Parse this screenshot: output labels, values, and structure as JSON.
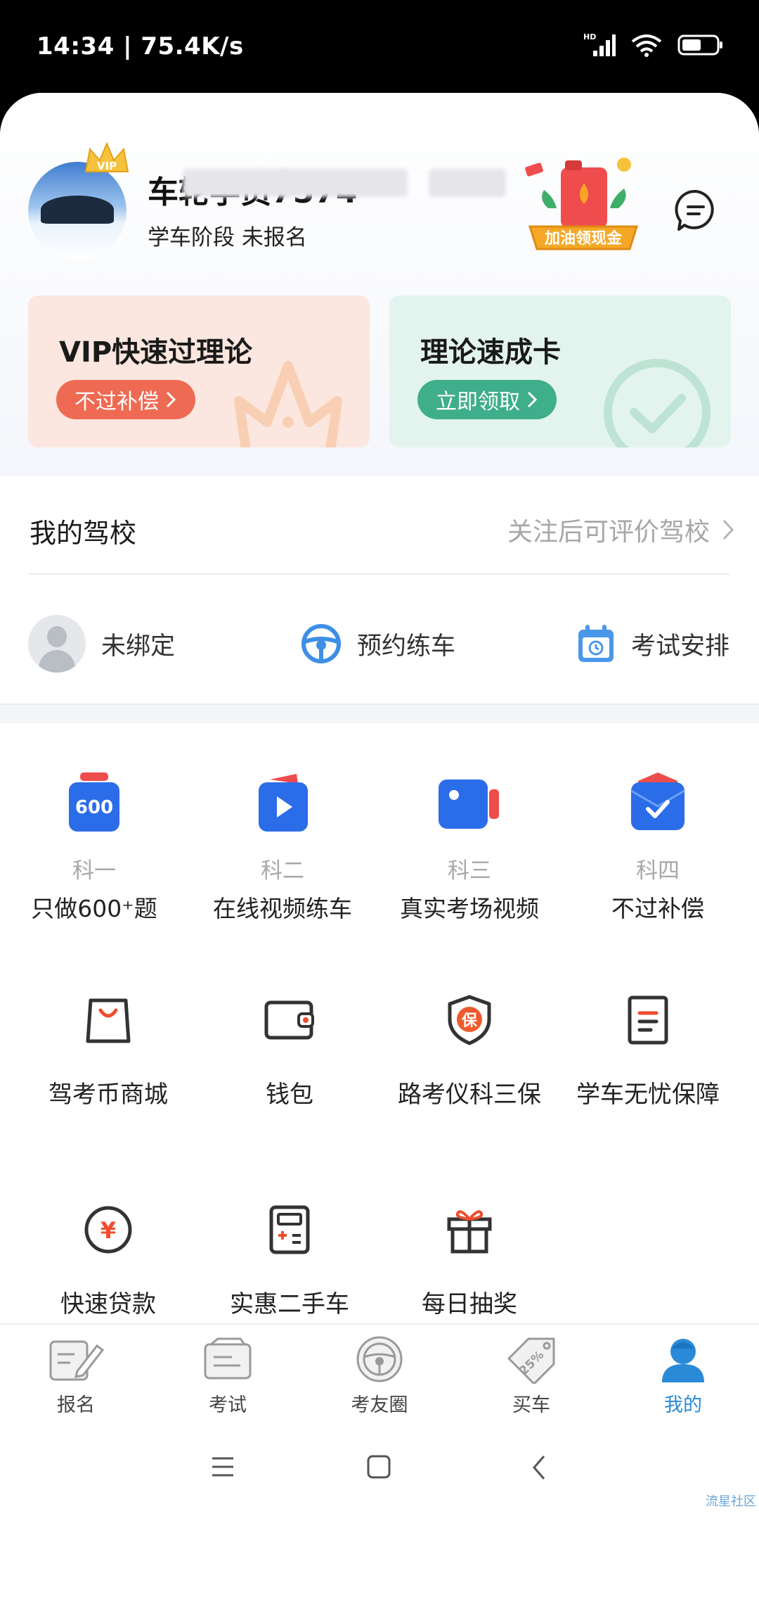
{
  "status_bar": {
    "time": "14:34 | 75.4K/s",
    "network_badge": "HD"
  },
  "profile": {
    "username": "车轮学员7574",
    "stage": "学车阶段 未报名",
    "promo_text": "加油领现金",
    "vip_badge": "VIP"
  },
  "cards": {
    "vip": {
      "title": "VIP快速过理论",
      "button": "不过补偿"
    },
    "theory": {
      "title": "理论速成卡",
      "button": "立即领取"
    }
  },
  "school": {
    "title": "我的驾校",
    "link": "关注后可评价驾校",
    "shortcuts": [
      {
        "label": "未绑定",
        "icon": "coach-avatar"
      },
      {
        "label": "预约练车",
        "icon": "steering-wheel-icon"
      },
      {
        "label": "考试安排",
        "icon": "calendar-icon"
      }
    ]
  },
  "subjects": [
    {
      "sub": "科一",
      "main": "只做600⁺题",
      "badge": "600",
      "color": "#2b6de8"
    },
    {
      "sub": "科二",
      "main": "在线视频练车",
      "color": "#2b6de8"
    },
    {
      "sub": "科三",
      "main": "真实考场视频",
      "color": "#2b6de8"
    },
    {
      "sub": "科四",
      "main": "不过补偿",
      "color": "#2b6de8"
    }
  ],
  "services": [
    {
      "label": "驾考币商城",
      "icon": "shopping-bag-icon"
    },
    {
      "label": "钱包",
      "icon": "wallet-icon"
    },
    {
      "label": "路考仪科三保",
      "icon": "shield-icon",
      "icon_text": "保"
    },
    {
      "label": "学车无忧保障",
      "icon": "document-icon"
    },
    {
      "label": "快速贷款",
      "icon": "yen-coin-icon",
      "icon_text": "¥"
    },
    {
      "label": "实惠二手车",
      "icon": "calculator-icon"
    },
    {
      "label": "每日抽奖",
      "icon": "gift-icon"
    }
  ],
  "tabs": [
    {
      "label": "报名",
      "icon": "signup-icon"
    },
    {
      "label": "考试",
      "icon": "exam-icon"
    },
    {
      "label": "考友圈",
      "icon": "community-icon"
    },
    {
      "label": "买车",
      "icon": "buy-car-icon",
      "icon_text": "25%"
    },
    {
      "label": "我的",
      "icon": "profile-icon",
      "active": true
    }
  ],
  "watermark": "流星社区",
  "colors": {
    "accent_blue": "#2a8ad8",
    "vip_orange": "#ef6a52",
    "theory_green": "#3fae8a"
  }
}
